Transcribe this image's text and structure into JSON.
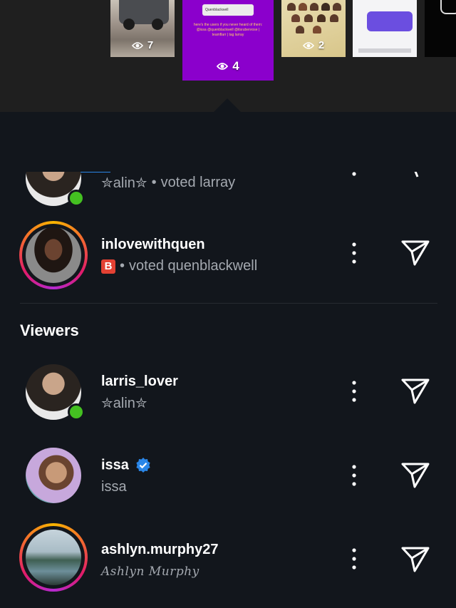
{
  "stories": [
    {
      "views": "7"
    },
    {
      "views": "4",
      "caption": "here's the users if you never heard of them: @issa @quenblackwell @itsrubenrose | teamflarr | tag larray",
      "poll_option": "Quenblackwell"
    },
    {
      "views": "2"
    },
    {
      "views": ""
    }
  ],
  "tabs": {
    "viewers_count": "4"
  },
  "viewers_section_title": "Viewers",
  "voters": [
    {
      "username": "",
      "subtitle": "✮alin✮",
      "vote": "voted larray",
      "online": true
    },
    {
      "username": "inlovewithquen",
      "badge": "B",
      "vote": "voted quenblackwell",
      "online": false
    }
  ],
  "viewers": [
    {
      "username": "larris_lover",
      "subtitle": "✮alin✮",
      "online": true,
      "verified": false
    },
    {
      "username": "issa",
      "subtitle": "issa",
      "online": false,
      "verified": true
    },
    {
      "username": "ashlyn.murphy27",
      "subtitle": "Ashlyn Murphy",
      "online": false,
      "verified": false
    }
  ],
  "colors": {
    "accent_blue": "#2a86e8",
    "background": "#12161c",
    "story_purple": "#8b00cc",
    "online_green": "#44c021",
    "badge_red": "#e34133"
  }
}
